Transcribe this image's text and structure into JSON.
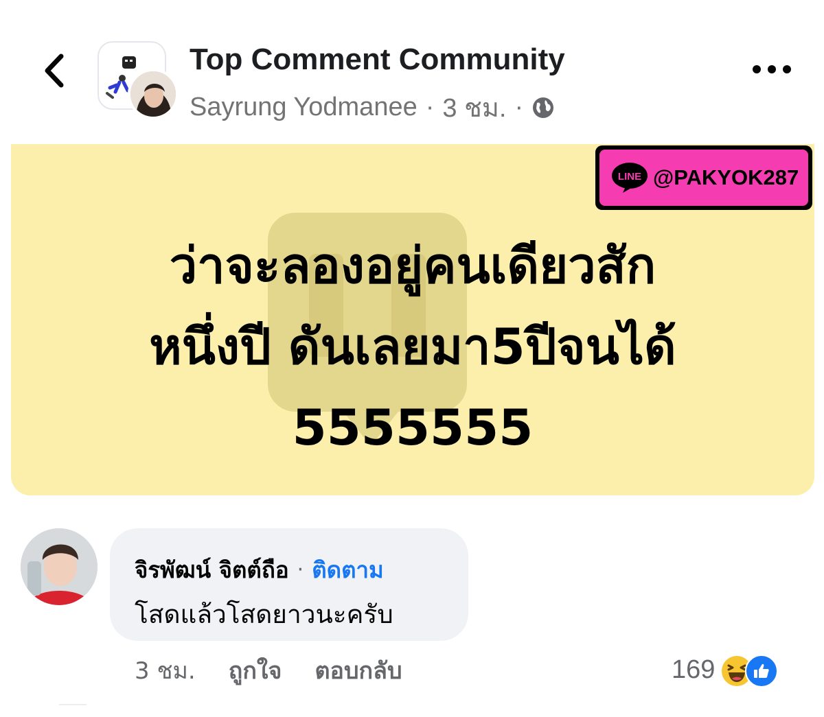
{
  "header": {
    "group_name": "Top Comment Community",
    "author": "Sayrung Yodmanee",
    "separator": "·",
    "time": "3 ชม."
  },
  "post": {
    "line_id": "@PAKYOK287",
    "line_logo_text": "LINE",
    "text_lines": [
      "ว่าจะลองอยู่คนเดียวสัก",
      "หนึ่งปี ดันเลยมา5ปีจนได้",
      "5555555"
    ],
    "background_color": "#fbefab",
    "badge_color": "#f53db1"
  },
  "comment": {
    "author": "จิรพัฒน์ จิตต์ถือ",
    "separator": "·",
    "follow_label": "ติดตาม",
    "text": "โสดแล้วโสดยาวนะครับ",
    "time": "3 ชม.",
    "like_label": "ถูกใจ",
    "reply_label": "ตอบกลับ",
    "reaction_count": "169",
    "reactions": [
      "haha-icon",
      "like-icon"
    ]
  },
  "colors": {
    "accent": "#1877f2",
    "secondary_text": "#65676b"
  }
}
